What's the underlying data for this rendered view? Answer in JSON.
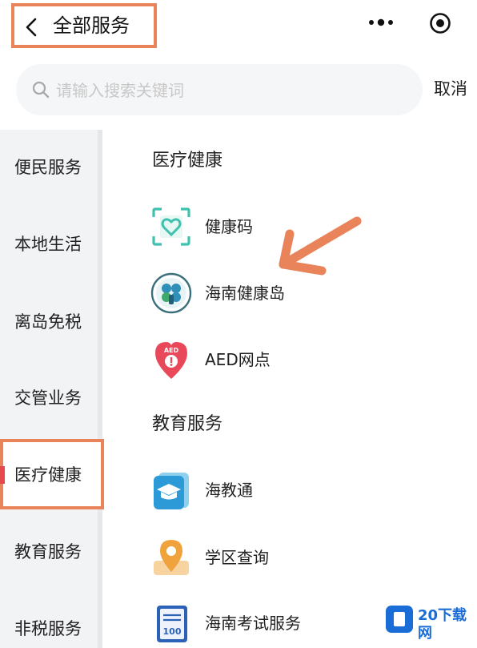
{
  "header": {
    "title": "全部服务"
  },
  "search": {
    "placeholder": "请输入搜索关键词",
    "value": "",
    "cancel_label": "取消"
  },
  "sidebar": {
    "items": [
      {
        "label": "便民服务"
      },
      {
        "label": "本地生活"
      },
      {
        "label": "离岛免税"
      },
      {
        "label": "交管业务"
      },
      {
        "label": "医疗健康",
        "active": true
      },
      {
        "label": "教育服务"
      },
      {
        "label": "非税服务"
      }
    ]
  },
  "sections": [
    {
      "title": "医疗健康",
      "items": [
        {
          "label": "健康码",
          "icon": "health-code-icon"
        },
        {
          "label": "海南健康岛",
          "icon": "health-island-icon"
        },
        {
          "label": "AED网点",
          "icon": "aed-icon"
        }
      ]
    },
    {
      "title": "教育服务",
      "items": [
        {
          "label": "海教通",
          "icon": "education-app-icon"
        },
        {
          "label": "学区查询",
          "icon": "location-pin-icon"
        },
        {
          "label": "海南考试服务",
          "icon": "exam-paper-icon"
        }
      ]
    }
  ],
  "watermark": {
    "label": "20下载网"
  },
  "colors": {
    "highlight": "#e8835a",
    "active_marker": "#e5484d",
    "teal": "#3fc1b0",
    "red": "#e8485a",
    "blue": "#2c8fe0",
    "orange": "#f0a23c"
  }
}
